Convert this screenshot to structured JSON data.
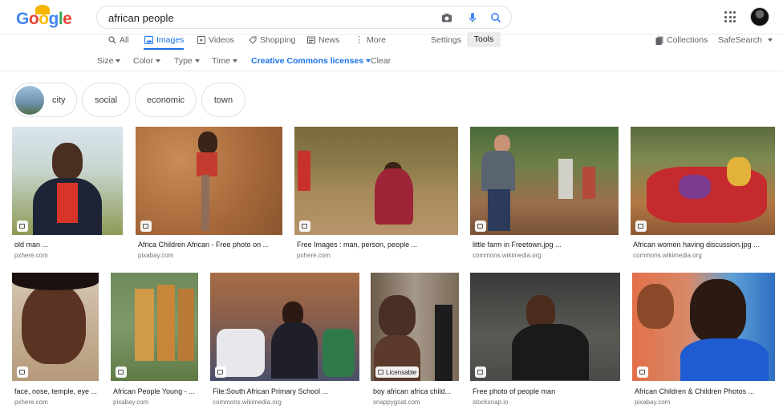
{
  "brand": {
    "logo": "Google"
  },
  "search": {
    "query": "african people"
  },
  "tabs": [
    {
      "label": "All",
      "icon": "search-icon"
    },
    {
      "label": "Images",
      "icon": "image-icon"
    },
    {
      "label": "Videos",
      "icon": "play-icon"
    },
    {
      "label": "Shopping",
      "icon": "tag-icon"
    },
    {
      "label": "News",
      "icon": "newspaper-icon"
    },
    {
      "label": "More",
      "icon": "more-vert-icon"
    }
  ],
  "toolbar": {
    "settings": "Settings",
    "tools": "Tools",
    "collections": "Collections",
    "safesearch": "SafeSearch"
  },
  "filters": {
    "size": "Size",
    "color": "Color",
    "type": "Type",
    "time": "Time",
    "license": "Creative Commons licenses",
    "clear": "Clear"
  },
  "chips": [
    {
      "label": "city"
    },
    {
      "label": "social"
    },
    {
      "label": "economic"
    },
    {
      "label": "town"
    }
  ],
  "results": [
    {
      "caption": "old man ...",
      "source": "pxhere.com"
    },
    {
      "caption": "Africa Children African - Free photo on ...",
      "source": "pixabay.com"
    },
    {
      "caption": "Free Images : man, person, people ...",
      "source": "pxhere.com"
    },
    {
      "caption": "little farm in Freetown.jpg ...",
      "source": "commons.wikimedia.org"
    },
    {
      "caption": "African women having discussion.jpg ...",
      "source": "commons.wikimedia.org"
    },
    {
      "caption": "face, nose, temple, eye ...",
      "source": "pxhere.com"
    },
    {
      "caption": "African People Young - ...",
      "source": "pixabay.com"
    },
    {
      "caption": "File:South African Primary School ...",
      "source": "commons.wikimedia.org"
    },
    {
      "caption": "boy african africa child...",
      "source": "snappygoat.com",
      "badge": "Licensable"
    },
    {
      "caption": "Free photo of people man",
      "source": "stocksnap.io"
    },
    {
      "caption": "African Children & Children Photos ...",
      "source": "pixabay.com"
    }
  ],
  "colors": {
    "accent": "#1a73e8",
    "muted": "#5f6368",
    "border": "#dfe1e5"
  }
}
